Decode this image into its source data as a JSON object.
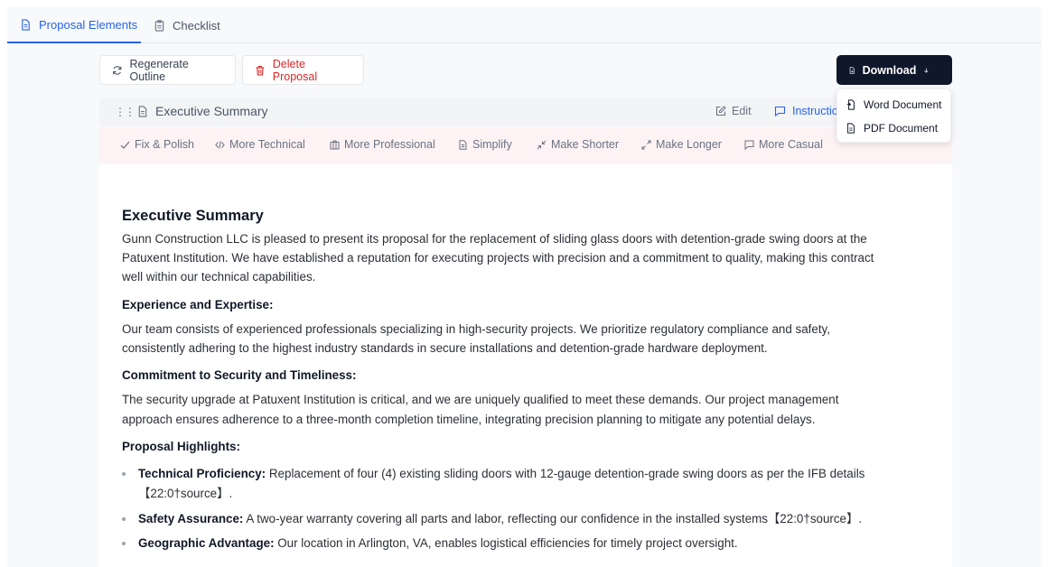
{
  "tabs": [
    {
      "label": "Proposal Elements",
      "active": true,
      "icon": "document-icon"
    },
    {
      "label": "Checklist",
      "active": false,
      "icon": "clipboard-icon"
    }
  ],
  "toolbar": {
    "regenerate_label": "Regenerate Outline",
    "delete_label": "Delete Proposal",
    "download_label": "Download"
  },
  "download_menu": {
    "items": [
      {
        "label": "Word Document",
        "icon": "word-file-icon"
      },
      {
        "label": "PDF Document",
        "icon": "pdf-file-icon"
      }
    ]
  },
  "section": {
    "title": "Executive Summary",
    "edit_label": "Edit",
    "instructions_label": "Instructio"
  },
  "actions": [
    {
      "label": "Fix & Polish",
      "icon": "check-icon"
    },
    {
      "label": "More Technical",
      "icon": "code-icon"
    },
    {
      "label": "More Professional",
      "icon": "building-icon"
    },
    {
      "label": "Simplify",
      "icon": "document-icon"
    },
    {
      "label": "Make Shorter",
      "icon": "shrink-icon"
    },
    {
      "label": "Make Longer",
      "icon": "expand-icon"
    },
    {
      "label": "More Casual",
      "icon": "chat-icon"
    }
  ],
  "content": {
    "heading": "Executive Summary",
    "intro": [
      "Gunn Construction LLC is pleased to present its proposal for the replacement of sliding glass doors with detention-grade swing doors at the",
      "Patuxent Institution. We have established a reputation for executing projects with precision and a commitment to quality, making this contract",
      "well within our technical capabilities."
    ],
    "experience_heading": "Experience and Expertise:",
    "experience": [
      "Our team consists of experienced professionals specializing in high-security projects. We prioritize regulatory compliance and safety,",
      "consistently adhering to the highest industry standards in secure installations and detention-grade hardware deployment."
    ],
    "commitment_heading": "Commitment to Security and Timeliness:",
    "commitment": [
      "The security upgrade at Patuxent Institution is critical, and we are uniquely qualified to meet these demands. Our project management",
      "approach ensures adherence to a three-month completion timeline, integrating precision planning to mitigate any potential delays."
    ],
    "highlights_heading": "Proposal Highlights:",
    "highlights": [
      {
        "label": "Technical Proficiency:",
        "text": " Replacement of four (4) existing sliding doors with 12-gauge detention-grade swing doors as per the IFB details",
        "cont": "【22:0†source】."
      },
      {
        "label": "Safety Assurance:",
        "text": " A two-year warranty covering all parts and labor, reflecting our confidence in the installed systems【22:0†source】.",
        "cont": ""
      },
      {
        "label": "Geographic Advantage:",
        "text": " Our location in Arlington, VA, enables logistical efficiencies for timely project oversight.",
        "cont": ""
      }
    ]
  },
  "colors": {
    "accent": "#2563eb",
    "danger": "#dc2626",
    "download_bg": "#0f172a",
    "toolbar_bg": "#fdf2f4"
  }
}
